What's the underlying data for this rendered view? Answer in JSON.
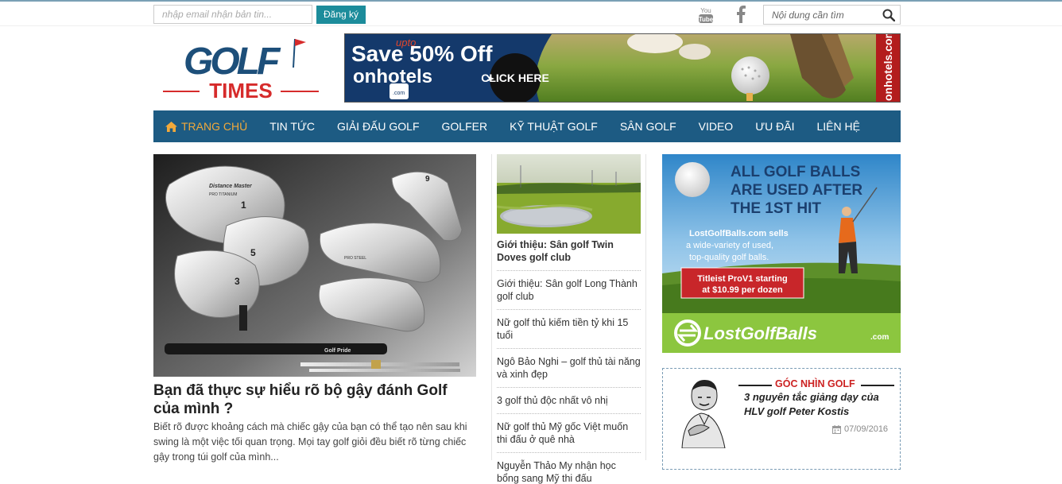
{
  "topbar": {
    "email_placeholder": "nhập email nhận bản tin...",
    "subscribe_label": "Đăng ký",
    "search_placeholder": "Nội dung cần tìm",
    "youtube_icon": "youtube-icon",
    "facebook_icon": "facebook-icon"
  },
  "logo": {
    "word1": "GOLF",
    "word2": "TIMES"
  },
  "banner_top": {
    "upto": "upto",
    "headline": "Save 50% Off",
    "brand": "onhotels",
    "brand_dot": ".com",
    "cta": "CLICK HERE",
    "side": "onhotels.com"
  },
  "nav": {
    "items": [
      {
        "label": "TRANG CHỦ",
        "active": true
      },
      {
        "label": "TIN TỨC"
      },
      {
        "label": "GIẢI ĐẤU GOLF"
      },
      {
        "label": "GOLFER"
      },
      {
        "label": "KỸ THUẬT GOLF"
      },
      {
        "label": "SÂN GOLF"
      },
      {
        "label": "VIDEO"
      },
      {
        "label": "ƯU ĐÃI"
      },
      {
        "label": "LIÊN HỆ"
      }
    ]
  },
  "main_article": {
    "title": "Bạn đã thực sự hiểu rõ bộ gậy đánh Golf của mình ?",
    "description": "Biết rõ được khoảng cách mà chiếc gậy của bạn có thể tạo nên sau khi swing là một việc tối quan trọng. Mọi tay golf giỏi đều biết rõ từng chiếc gậy trong túi golf của mình...",
    "image_labels": {
      "brand": "Distance Master",
      "pro_titanium": "PRO TITANIUM",
      "pro_steel": "PRO STEEL",
      "grip": "Golf Pride",
      "num1": "1",
      "num3": "3",
      "num5": "5",
      "num9": "9"
    }
  },
  "side_list": {
    "items": [
      "Giới thiệu: Sân golf Twin Doves golf club",
      "Giới thiệu: Sân golf Long Thành golf club",
      "Nữ golf thủ kiếm tiền tỷ khi 15 tuổi",
      "Ngô Bảo Nghi – golf thủ tài năng và xinh đẹp",
      "3 golf thủ độc nhất vô nhị",
      "Nữ golf thủ Mỹ gốc Việt muốn thi đấu ở quê nhà",
      "Nguyễn Thảo My nhận học bổng sang Mỹ thi đấu"
    ]
  },
  "ad_right": {
    "line1": "ALL GOLF BALLS",
    "line2": "ARE USED AFTER",
    "line3": "THE 1ST HIT",
    "body1": "LostGolfBalls.com sells",
    "body2": "a wide-variety of used,",
    "body3": "top-quality golf balls.",
    "offer1": "Titleist ProV1 starting",
    "offer2": "at $10.99 per dozen",
    "brand": "LostGolfBalls",
    "brand_tld": ".com"
  },
  "goc_nhin": {
    "header": "GÓC NHÌN GOLF",
    "article_title": "3 nguyên tắc giảng dạy của HLV golf Peter Kostis",
    "date": "07/09/2016"
  },
  "colors": {
    "nav_bg": "#1d5b83",
    "nav_active": "#f1a93b",
    "subscribe_btn": "#1c8c9b",
    "accent_red": "#cc2222"
  }
}
